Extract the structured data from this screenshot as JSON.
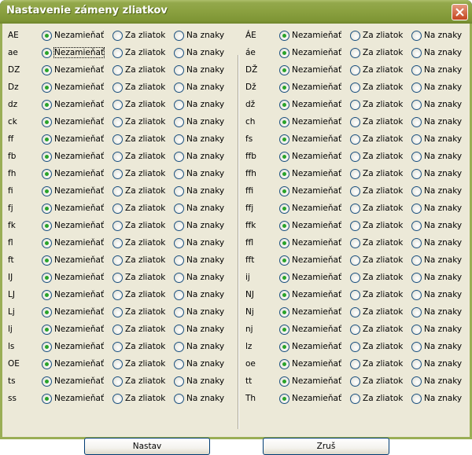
{
  "window": {
    "title": "Nastavenie zámeny zliatkov"
  },
  "options": {
    "none": "Nezamieňať",
    "ligature": "Za zliatok",
    "chars": "Na znaky"
  },
  "left": [
    {
      "label": "AE",
      "selected": "none"
    },
    {
      "label": "ae",
      "selected": "none"
    },
    {
      "label": "DZ",
      "selected": "none"
    },
    {
      "label": "Dz",
      "selected": "none"
    },
    {
      "label": "dz",
      "selected": "none"
    },
    {
      "label": "ck",
      "selected": "none"
    },
    {
      "label": "ff",
      "selected": "none"
    },
    {
      "label": "fb",
      "selected": "none"
    },
    {
      "label": "fh",
      "selected": "none"
    },
    {
      "label": "fi",
      "selected": "none"
    },
    {
      "label": "fj",
      "selected": "none"
    },
    {
      "label": "fk",
      "selected": "none"
    },
    {
      "label": "fl",
      "selected": "none"
    },
    {
      "label": "ft",
      "selected": "none"
    },
    {
      "label": "IJ",
      "selected": "none"
    },
    {
      "label": "LJ",
      "selected": "none"
    },
    {
      "label": "Lj",
      "selected": "none"
    },
    {
      "label": "lj",
      "selected": "none"
    },
    {
      "label": "ls",
      "selected": "none"
    },
    {
      "label": "OE",
      "selected": "none"
    },
    {
      "label": "ts",
      "selected": "none"
    },
    {
      "label": "ss",
      "selected": "none"
    }
  ],
  "right": [
    {
      "label": "ÁE",
      "selected": "none"
    },
    {
      "label": "áe",
      "selected": "none"
    },
    {
      "label": "DŽ",
      "selected": "none"
    },
    {
      "label": "Dž",
      "selected": "none"
    },
    {
      "label": "dž",
      "selected": "none"
    },
    {
      "label": "ch",
      "selected": "none"
    },
    {
      "label": "fs",
      "selected": "none"
    },
    {
      "label": "ffb",
      "selected": "none"
    },
    {
      "label": "ffh",
      "selected": "none"
    },
    {
      "label": "ffi",
      "selected": "none"
    },
    {
      "label": "ffj",
      "selected": "none"
    },
    {
      "label": "ffk",
      "selected": "none"
    },
    {
      "label": "ffl",
      "selected": "none"
    },
    {
      "label": "fft",
      "selected": "none"
    },
    {
      "label": "ij",
      "selected": "none"
    },
    {
      "label": "NJ",
      "selected": "none"
    },
    {
      "label": "Nj",
      "selected": "none"
    },
    {
      "label": "nj",
      "selected": "none"
    },
    {
      "label": "lz",
      "selected": "none"
    },
    {
      "label": "oe",
      "selected": "none"
    },
    {
      "label": "tt",
      "selected": "none"
    },
    {
      "label": "Th",
      "selected": "none"
    }
  ],
  "buttons": {
    "ok": "Nastav",
    "cancel": "Zruš"
  },
  "colors": {
    "titlebar": "#8aa03f",
    "dialog_bg": "#ece9d8",
    "radio_dot": "#29a329",
    "close": "#c5451f"
  }
}
